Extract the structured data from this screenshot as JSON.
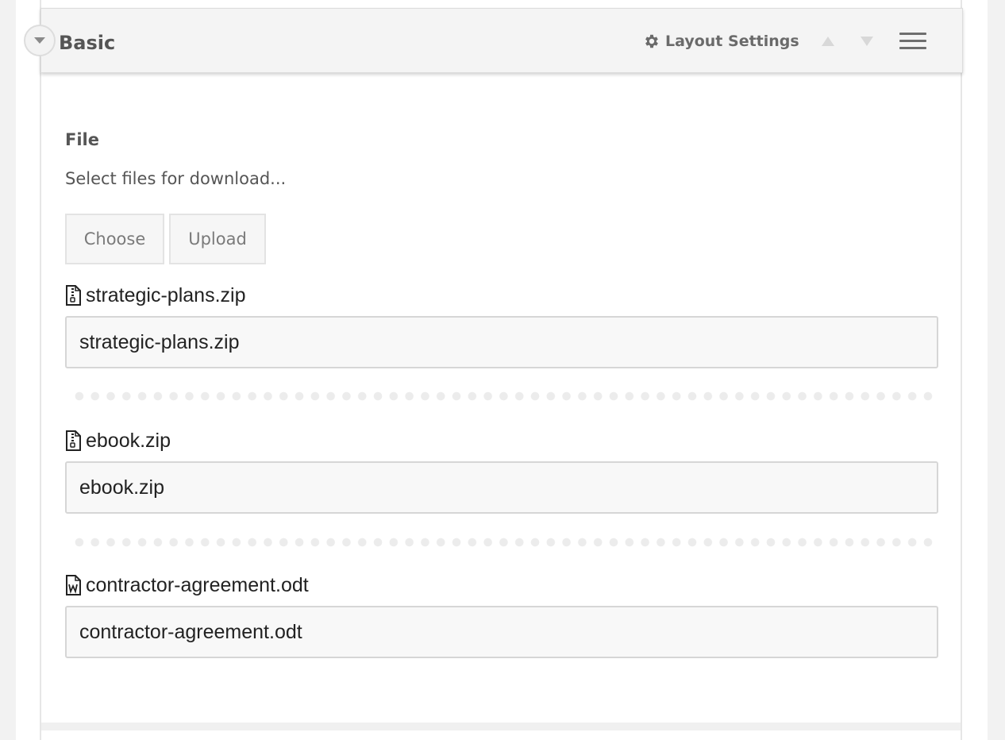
{
  "section": {
    "title": "Basic",
    "layout_settings_label": "Layout Settings",
    "move_up_icon": "triangle-up",
    "move_down_icon": "triangle-down",
    "menu_icon": "hamburger"
  },
  "field": {
    "label": "File",
    "help": "Select files for download...",
    "choose_label": "Choose",
    "upload_label": "Upload"
  },
  "files": [
    {
      "name": "strategic-plans.zip",
      "value": "strategic-plans.zip",
      "icon": "zip-file-icon"
    },
    {
      "name": "ebook.zip",
      "value": "ebook.zip",
      "icon": "zip-file-icon"
    },
    {
      "name": "contractor-agreement.odt",
      "value": "contractor-agreement.odt",
      "icon": "word-file-icon"
    }
  ],
  "colors": {
    "header_bg": "#f4f4f4",
    "text_dark": "#555555",
    "button_text": "#7a7a7a",
    "border": "#d6d6d6"
  }
}
